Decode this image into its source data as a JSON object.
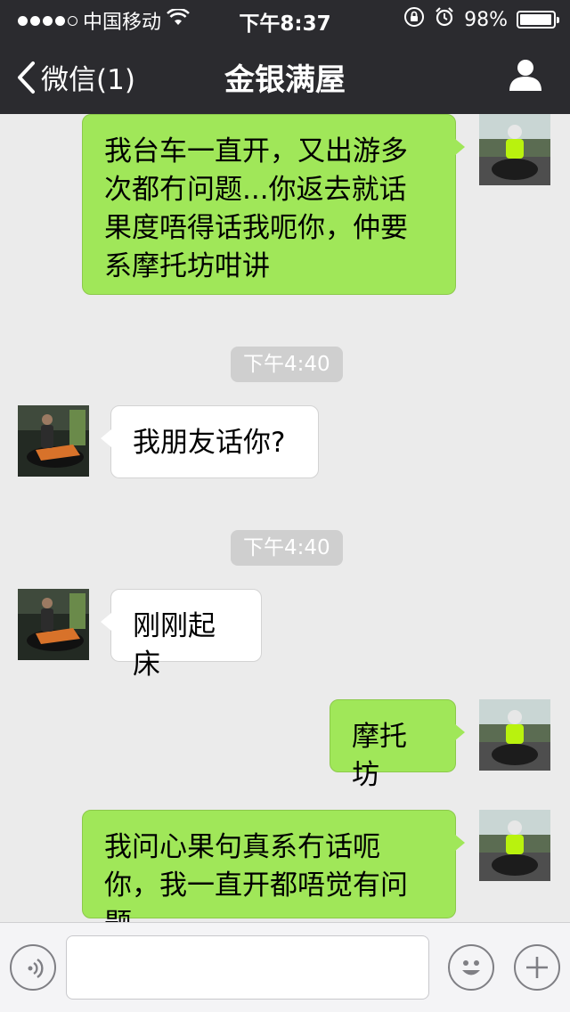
{
  "status_bar": {
    "carrier": "中国移动",
    "time": "下午8:37",
    "battery": "98%",
    "battery_level": 0.98,
    "signal_bars": 4
  },
  "nav": {
    "back_label": "微信(1)",
    "title": "金银满屋",
    "icons": {
      "back": "chevron-left-icon",
      "profile": "person-icon"
    }
  },
  "messages": [
    {
      "sender": "me",
      "text": "我台车一直开，又出游多次都冇问题...你返去就话果度唔得话我呃你，仲要系摩托坊咁讲"
    },
    {
      "type": "timestamp",
      "text": "下午4:40"
    },
    {
      "sender": "other",
      "text": "我朋友话你?"
    },
    {
      "type": "timestamp",
      "text": "下午4:40"
    },
    {
      "sender": "other",
      "text": "刚刚起床"
    },
    {
      "sender": "me",
      "text": "摩托坊"
    },
    {
      "sender": "me",
      "text": "我问心果句真系冇话呃你，我一直开都唔觉有问题"
    }
  ],
  "input_bar": {
    "icons": {
      "voice": "voice-icon",
      "emoji": "emoji-icon",
      "more": "plus-icon"
    },
    "text_value": ""
  },
  "colors": {
    "header_bg": "#2b2b2f",
    "chat_bg": "#ebebeb",
    "my_bubble": "#a0e759",
    "other_bubble": "#ffffff",
    "timestamp_bg": "#cfcfcf"
  }
}
